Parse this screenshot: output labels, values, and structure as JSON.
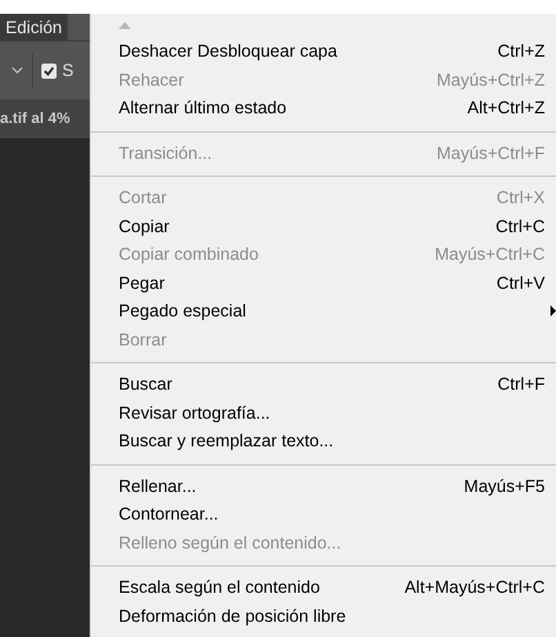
{
  "menu_bar": {
    "label": "Edición"
  },
  "options_bar": {
    "checkbox": {
      "label": "S",
      "checked": true
    }
  },
  "document_tab": {
    "label": "a.tif al 4%"
  },
  "menu": {
    "items": [
      {
        "kind": "scroll-up"
      },
      {
        "kind": "item",
        "label": "Deshacer Desbloquear capa",
        "shortcut": "Ctrl+Z",
        "disabled": false
      },
      {
        "kind": "item",
        "label": "Rehacer",
        "shortcut": "Mayús+Ctrl+Z",
        "disabled": true
      },
      {
        "kind": "item",
        "label": "Alternar último estado",
        "shortcut": "Alt+Ctrl+Z",
        "disabled": false
      },
      {
        "kind": "separator"
      },
      {
        "kind": "item",
        "label": "Transición...",
        "shortcut": "Mayús+Ctrl+F",
        "disabled": true
      },
      {
        "kind": "separator"
      },
      {
        "kind": "item",
        "label": "Cortar",
        "shortcut": "Ctrl+X",
        "disabled": true
      },
      {
        "kind": "item",
        "label": "Copiar",
        "shortcut": "Ctrl+C",
        "disabled": false
      },
      {
        "kind": "item",
        "label": "Copiar combinado",
        "shortcut": "Mayús+Ctrl+C",
        "disabled": true
      },
      {
        "kind": "item",
        "label": "Pegar",
        "shortcut": "Ctrl+V",
        "disabled": false
      },
      {
        "kind": "submenu",
        "label": "Pegado especial",
        "disabled": false
      },
      {
        "kind": "item",
        "label": "Borrar",
        "disabled": true
      },
      {
        "kind": "separator"
      },
      {
        "kind": "item",
        "label": "Buscar",
        "shortcut": "Ctrl+F",
        "disabled": false
      },
      {
        "kind": "item",
        "label": "Revisar ortografía...",
        "disabled": false
      },
      {
        "kind": "item",
        "label": "Buscar y reemplazar texto...",
        "disabled": false
      },
      {
        "kind": "separator"
      },
      {
        "kind": "item",
        "label": "Rellenar...",
        "shortcut": "Mayús+F5",
        "disabled": false
      },
      {
        "kind": "item",
        "label": "Contornear...",
        "disabled": false
      },
      {
        "kind": "item",
        "label": "Relleno según el contenido...",
        "disabled": true
      },
      {
        "kind": "separator"
      },
      {
        "kind": "item",
        "label": "Escala según el contenido",
        "shortcut": "Alt+Mayús+Ctrl+C",
        "disabled": false
      },
      {
        "kind": "item",
        "label": "Deformación de posición libre",
        "disabled": false
      }
    ]
  }
}
